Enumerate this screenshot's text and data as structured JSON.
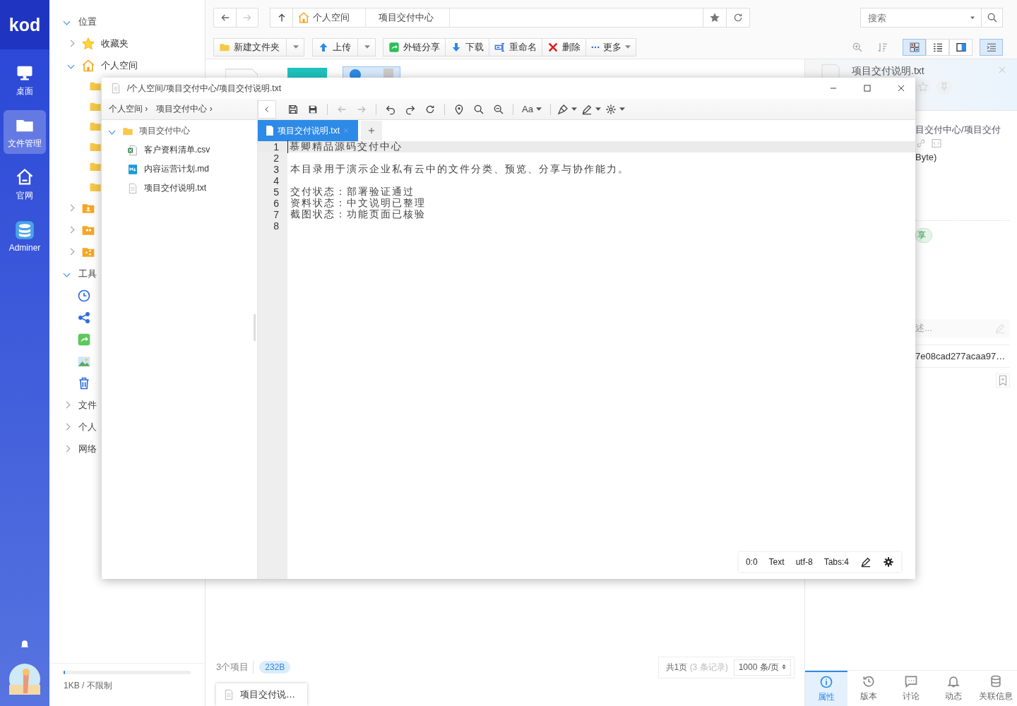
{
  "rail": {
    "logo": "kod",
    "items": [
      {
        "label": "桌面",
        "selected": false
      },
      {
        "label": "文件管理",
        "selected": true
      },
      {
        "label": "官网",
        "selected": false
      },
      {
        "label": "Adminer",
        "selected": false
      }
    ]
  },
  "sidebar": {
    "sections": [
      {
        "title": "位置",
        "expanded": true,
        "items": [
          {
            "label": "收藏夹",
            "expanded": false
          },
          {
            "label": "个人空间",
            "expanded": true,
            "children": [
              {
                "kind": "folder"
              },
              {
                "kind": "folder"
              },
              {
                "kind": "folder"
              },
              {
                "kind": "folder"
              },
              {
                "kind": "folder"
              },
              {
                "kind": "folder"
              }
            ]
          },
          {
            "expanded": false
          },
          {
            "expanded": false
          },
          {
            "expanded": false
          }
        ]
      },
      {
        "title": "工具",
        "expanded": true
      },
      {
        "title": "文件",
        "expanded": false
      },
      {
        "title": "个人",
        "expanded": false
      },
      {
        "title": "网络",
        "expanded": false
      }
    ],
    "quota": {
      "text": "1KB / 不限制",
      "level": 0.01
    }
  },
  "topbar": {
    "crumbs": [
      "个人空间",
      "项目交付中心"
    ],
    "search_placeholder": "搜索"
  },
  "toolbar": {
    "buttons": [
      {
        "label": "新建文件夹",
        "kind": "single",
        "dropdown": true
      },
      {
        "label": "上传",
        "kind": "single",
        "dropdown": true
      },
      {
        "label": "外链分享",
        "kind": "joined",
        "dropdown": false
      },
      {
        "label": "下载",
        "kind": "joined",
        "dropdown": false
      },
      {
        "label": "重命名",
        "kind": "joined",
        "dropdown": false
      },
      {
        "label": "删除",
        "kind": "joined",
        "dropdown": false
      },
      {
        "label": "更多",
        "kind": "joined",
        "dropdown": true
      }
    ],
    "view_modes": [
      {
        "selected": true
      },
      {
        "selected": false
      },
      {
        "selected": false
      }
    ],
    "panel_toggle": {
      "on": true
    }
  },
  "editor": {
    "title": "/个人空间/项目交付中心/项目交付说明.txt",
    "crumbs": [
      "个人空间 ›",
      "项目交付中心 ›"
    ],
    "font_button": "Aa",
    "tree": {
      "label": "项目交付中心",
      "expanded": true,
      "children": [
        {
          "label": "客户资料清单.csv",
          "kind": "sheet"
        },
        {
          "label": "内容运营计划.md",
          "kind": "markdown"
        },
        {
          "label": "项目交付说明.txt",
          "kind": "text"
        }
      ]
    },
    "tabs": [
      {
        "label": "项目交付说明.txt",
        "selected": true
      }
    ],
    "lines": [
      {
        "number": "1",
        "text": "慕卿精品源码交付中心"
      },
      {
        "number": "2"
      },
      {
        "number": "3",
        "text": "本目录用于演示企业私有云中的文件分类、预览、分享与协作能力。"
      },
      {
        "number": "4"
      },
      {
        "number": "5",
        "text": "交付状态：部署验证通过"
      },
      {
        "number": "6",
        "text": "资料状态：中文说明已整理"
      },
      {
        "number": "7",
        "text": "截图状态：功能页面已核验"
      },
      {
        "number": "8"
      }
    ],
    "status": [
      "0:0",
      "Text",
      "utf-8",
      "Tabs:4"
    ]
  },
  "info": {
    "title": "项目交付说明.txt",
    "path": "目交付中心/项目交付",
    "size": "Byte)",
    "tag": "享",
    "description_placeholder": "述...",
    "hash": "7e08cad277acaa97…",
    "tabs": [
      {
        "label": "属性",
        "selected": true
      },
      {
        "label": "版本",
        "selected": false
      },
      {
        "label": "讨论",
        "selected": false
      },
      {
        "label": "动态",
        "selected": false
      },
      {
        "label": "关联信息",
        "selected": false
      }
    ]
  },
  "footer": {
    "count": "3个项目",
    "size": "232B",
    "pages": "共1页",
    "records": "(3 条记录)",
    "per_page": "1000 条/页"
  },
  "taskbar": {
    "items": [
      {
        "label": "项目交付说…"
      }
    ]
  }
}
